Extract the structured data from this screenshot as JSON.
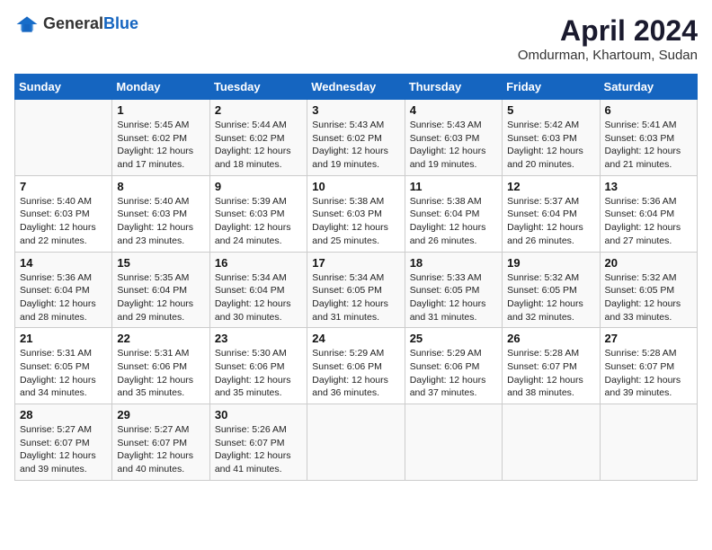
{
  "header": {
    "logo_general": "General",
    "logo_blue": "Blue",
    "month_year": "April 2024",
    "location": "Omdurman, Khartoum, Sudan"
  },
  "days_of_week": [
    "Sunday",
    "Monday",
    "Tuesday",
    "Wednesday",
    "Thursday",
    "Friday",
    "Saturday"
  ],
  "weeks": [
    [
      {
        "day": "",
        "empty": true
      },
      {
        "day": "1",
        "sunrise": "Sunrise: 5:45 AM",
        "sunset": "Sunset: 6:02 PM",
        "daylight": "Daylight: 12 hours and 17 minutes."
      },
      {
        "day": "2",
        "sunrise": "Sunrise: 5:44 AM",
        "sunset": "Sunset: 6:02 PM",
        "daylight": "Daylight: 12 hours and 18 minutes."
      },
      {
        "day": "3",
        "sunrise": "Sunrise: 5:43 AM",
        "sunset": "Sunset: 6:02 PM",
        "daylight": "Daylight: 12 hours and 19 minutes."
      },
      {
        "day": "4",
        "sunrise": "Sunrise: 5:43 AM",
        "sunset": "Sunset: 6:03 PM",
        "daylight": "Daylight: 12 hours and 19 minutes."
      },
      {
        "day": "5",
        "sunrise": "Sunrise: 5:42 AM",
        "sunset": "Sunset: 6:03 PM",
        "daylight": "Daylight: 12 hours and 20 minutes."
      },
      {
        "day": "6",
        "sunrise": "Sunrise: 5:41 AM",
        "sunset": "Sunset: 6:03 PM",
        "daylight": "Daylight: 12 hours and 21 minutes."
      }
    ],
    [
      {
        "day": "7",
        "sunrise": "Sunrise: 5:40 AM",
        "sunset": "Sunset: 6:03 PM",
        "daylight": "Daylight: 12 hours and 22 minutes."
      },
      {
        "day": "8",
        "sunrise": "Sunrise: 5:40 AM",
        "sunset": "Sunset: 6:03 PM",
        "daylight": "Daylight: 12 hours and 23 minutes."
      },
      {
        "day": "9",
        "sunrise": "Sunrise: 5:39 AM",
        "sunset": "Sunset: 6:03 PM",
        "daylight": "Daylight: 12 hours and 24 minutes."
      },
      {
        "day": "10",
        "sunrise": "Sunrise: 5:38 AM",
        "sunset": "Sunset: 6:03 PM",
        "daylight": "Daylight: 12 hours and 25 minutes."
      },
      {
        "day": "11",
        "sunrise": "Sunrise: 5:38 AM",
        "sunset": "Sunset: 6:04 PM",
        "daylight": "Daylight: 12 hours and 26 minutes."
      },
      {
        "day": "12",
        "sunrise": "Sunrise: 5:37 AM",
        "sunset": "Sunset: 6:04 PM",
        "daylight": "Daylight: 12 hours and 26 minutes."
      },
      {
        "day": "13",
        "sunrise": "Sunrise: 5:36 AM",
        "sunset": "Sunset: 6:04 PM",
        "daylight": "Daylight: 12 hours and 27 minutes."
      }
    ],
    [
      {
        "day": "14",
        "sunrise": "Sunrise: 5:36 AM",
        "sunset": "Sunset: 6:04 PM",
        "daylight": "Daylight: 12 hours and 28 minutes."
      },
      {
        "day": "15",
        "sunrise": "Sunrise: 5:35 AM",
        "sunset": "Sunset: 6:04 PM",
        "daylight": "Daylight: 12 hours and 29 minutes."
      },
      {
        "day": "16",
        "sunrise": "Sunrise: 5:34 AM",
        "sunset": "Sunset: 6:04 PM",
        "daylight": "Daylight: 12 hours and 30 minutes."
      },
      {
        "day": "17",
        "sunrise": "Sunrise: 5:34 AM",
        "sunset": "Sunset: 6:05 PM",
        "daylight": "Daylight: 12 hours and 31 minutes."
      },
      {
        "day": "18",
        "sunrise": "Sunrise: 5:33 AM",
        "sunset": "Sunset: 6:05 PM",
        "daylight": "Daylight: 12 hours and 31 minutes."
      },
      {
        "day": "19",
        "sunrise": "Sunrise: 5:32 AM",
        "sunset": "Sunset: 6:05 PM",
        "daylight": "Daylight: 12 hours and 32 minutes."
      },
      {
        "day": "20",
        "sunrise": "Sunrise: 5:32 AM",
        "sunset": "Sunset: 6:05 PM",
        "daylight": "Daylight: 12 hours and 33 minutes."
      }
    ],
    [
      {
        "day": "21",
        "sunrise": "Sunrise: 5:31 AM",
        "sunset": "Sunset: 6:05 PM",
        "daylight": "Daylight: 12 hours and 34 minutes."
      },
      {
        "day": "22",
        "sunrise": "Sunrise: 5:31 AM",
        "sunset": "Sunset: 6:06 PM",
        "daylight": "Daylight: 12 hours and 35 minutes."
      },
      {
        "day": "23",
        "sunrise": "Sunrise: 5:30 AM",
        "sunset": "Sunset: 6:06 PM",
        "daylight": "Daylight: 12 hours and 35 minutes."
      },
      {
        "day": "24",
        "sunrise": "Sunrise: 5:29 AM",
        "sunset": "Sunset: 6:06 PM",
        "daylight": "Daylight: 12 hours and 36 minutes."
      },
      {
        "day": "25",
        "sunrise": "Sunrise: 5:29 AM",
        "sunset": "Sunset: 6:06 PM",
        "daylight": "Daylight: 12 hours and 37 minutes."
      },
      {
        "day": "26",
        "sunrise": "Sunrise: 5:28 AM",
        "sunset": "Sunset: 6:07 PM",
        "daylight": "Daylight: 12 hours and 38 minutes."
      },
      {
        "day": "27",
        "sunrise": "Sunrise: 5:28 AM",
        "sunset": "Sunset: 6:07 PM",
        "daylight": "Daylight: 12 hours and 39 minutes."
      }
    ],
    [
      {
        "day": "28",
        "sunrise": "Sunrise: 5:27 AM",
        "sunset": "Sunset: 6:07 PM",
        "daylight": "Daylight: 12 hours and 39 minutes."
      },
      {
        "day": "29",
        "sunrise": "Sunrise: 5:27 AM",
        "sunset": "Sunset: 6:07 PM",
        "daylight": "Daylight: 12 hours and 40 minutes."
      },
      {
        "day": "30",
        "sunrise": "Sunrise: 5:26 AM",
        "sunset": "Sunset: 6:07 PM",
        "daylight": "Daylight: 12 hours and 41 minutes."
      },
      {
        "day": "",
        "empty": true
      },
      {
        "day": "",
        "empty": true
      },
      {
        "day": "",
        "empty": true
      },
      {
        "day": "",
        "empty": true
      }
    ]
  ]
}
